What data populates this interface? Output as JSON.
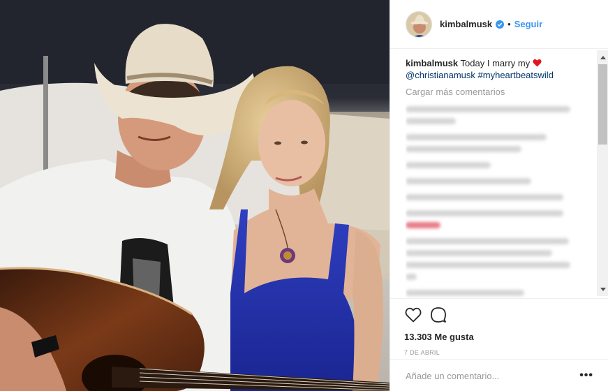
{
  "header": {
    "username": "kimbalmusk",
    "separator": "•",
    "follow_label": "Seguir"
  },
  "caption": {
    "username": "kimbalmusk",
    "text": "Today I marry my",
    "mention": "@christianamusk",
    "hashtag": "#myheartbeatswild"
  },
  "comments": {
    "load_more_label": "Cargar más comentarios"
  },
  "actions": {
    "likes_text": "13.303 Me gusta",
    "date": "7 DE ABRIL"
  },
  "add_comment": {
    "placeholder": "Añade un comentario...",
    "more_label": "•••"
  },
  "colors": {
    "link": "#3897f0",
    "mention": "#003569",
    "heart": "#ed4956",
    "verified": "#3897f0"
  }
}
